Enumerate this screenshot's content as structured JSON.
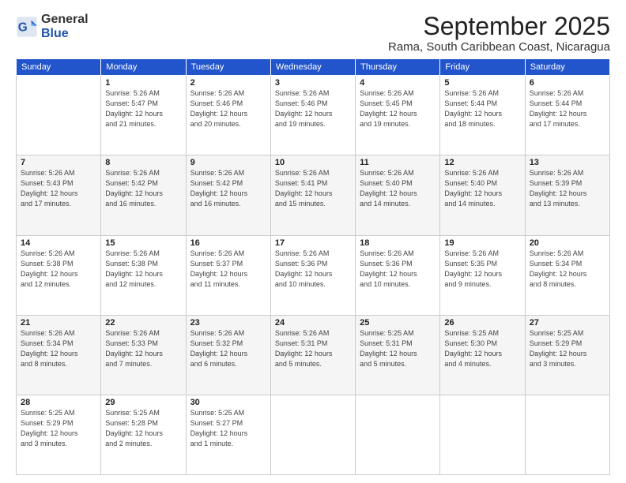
{
  "logo": {
    "text_general": "General",
    "text_blue": "Blue"
  },
  "title": "September 2025",
  "subtitle": "Rama, South Caribbean Coast, Nicaragua",
  "days_header": [
    "Sunday",
    "Monday",
    "Tuesday",
    "Wednesday",
    "Thursday",
    "Friday",
    "Saturday"
  ],
  "weeks": [
    [
      {
        "day": "",
        "info": ""
      },
      {
        "day": "1",
        "info": "Sunrise: 5:26 AM\nSunset: 5:47 PM\nDaylight: 12 hours\nand 21 minutes."
      },
      {
        "day": "2",
        "info": "Sunrise: 5:26 AM\nSunset: 5:46 PM\nDaylight: 12 hours\nand 20 minutes."
      },
      {
        "day": "3",
        "info": "Sunrise: 5:26 AM\nSunset: 5:46 PM\nDaylight: 12 hours\nand 19 minutes."
      },
      {
        "day": "4",
        "info": "Sunrise: 5:26 AM\nSunset: 5:45 PM\nDaylight: 12 hours\nand 19 minutes."
      },
      {
        "day": "5",
        "info": "Sunrise: 5:26 AM\nSunset: 5:44 PM\nDaylight: 12 hours\nand 18 minutes."
      },
      {
        "day": "6",
        "info": "Sunrise: 5:26 AM\nSunset: 5:44 PM\nDaylight: 12 hours\nand 17 minutes."
      }
    ],
    [
      {
        "day": "7",
        "info": "Sunrise: 5:26 AM\nSunset: 5:43 PM\nDaylight: 12 hours\nand 17 minutes."
      },
      {
        "day": "8",
        "info": "Sunrise: 5:26 AM\nSunset: 5:42 PM\nDaylight: 12 hours\nand 16 minutes."
      },
      {
        "day": "9",
        "info": "Sunrise: 5:26 AM\nSunset: 5:42 PM\nDaylight: 12 hours\nand 16 minutes."
      },
      {
        "day": "10",
        "info": "Sunrise: 5:26 AM\nSunset: 5:41 PM\nDaylight: 12 hours\nand 15 minutes."
      },
      {
        "day": "11",
        "info": "Sunrise: 5:26 AM\nSunset: 5:40 PM\nDaylight: 12 hours\nand 14 minutes."
      },
      {
        "day": "12",
        "info": "Sunrise: 5:26 AM\nSunset: 5:40 PM\nDaylight: 12 hours\nand 14 minutes."
      },
      {
        "day": "13",
        "info": "Sunrise: 5:26 AM\nSunset: 5:39 PM\nDaylight: 12 hours\nand 13 minutes."
      }
    ],
    [
      {
        "day": "14",
        "info": "Sunrise: 5:26 AM\nSunset: 5:38 PM\nDaylight: 12 hours\nand 12 minutes."
      },
      {
        "day": "15",
        "info": "Sunrise: 5:26 AM\nSunset: 5:38 PM\nDaylight: 12 hours\nand 12 minutes."
      },
      {
        "day": "16",
        "info": "Sunrise: 5:26 AM\nSunset: 5:37 PM\nDaylight: 12 hours\nand 11 minutes."
      },
      {
        "day": "17",
        "info": "Sunrise: 5:26 AM\nSunset: 5:36 PM\nDaylight: 12 hours\nand 10 minutes."
      },
      {
        "day": "18",
        "info": "Sunrise: 5:26 AM\nSunset: 5:36 PM\nDaylight: 12 hours\nand 10 minutes."
      },
      {
        "day": "19",
        "info": "Sunrise: 5:26 AM\nSunset: 5:35 PM\nDaylight: 12 hours\nand 9 minutes."
      },
      {
        "day": "20",
        "info": "Sunrise: 5:26 AM\nSunset: 5:34 PM\nDaylight: 12 hours\nand 8 minutes."
      }
    ],
    [
      {
        "day": "21",
        "info": "Sunrise: 5:26 AM\nSunset: 5:34 PM\nDaylight: 12 hours\nand 8 minutes."
      },
      {
        "day": "22",
        "info": "Sunrise: 5:26 AM\nSunset: 5:33 PM\nDaylight: 12 hours\nand 7 minutes."
      },
      {
        "day": "23",
        "info": "Sunrise: 5:26 AM\nSunset: 5:32 PM\nDaylight: 12 hours\nand 6 minutes."
      },
      {
        "day": "24",
        "info": "Sunrise: 5:26 AM\nSunset: 5:31 PM\nDaylight: 12 hours\nand 5 minutes."
      },
      {
        "day": "25",
        "info": "Sunrise: 5:25 AM\nSunset: 5:31 PM\nDaylight: 12 hours\nand 5 minutes."
      },
      {
        "day": "26",
        "info": "Sunrise: 5:25 AM\nSunset: 5:30 PM\nDaylight: 12 hours\nand 4 minutes."
      },
      {
        "day": "27",
        "info": "Sunrise: 5:25 AM\nSunset: 5:29 PM\nDaylight: 12 hours\nand 3 minutes."
      }
    ],
    [
      {
        "day": "28",
        "info": "Sunrise: 5:25 AM\nSunset: 5:29 PM\nDaylight: 12 hours\nand 3 minutes."
      },
      {
        "day": "29",
        "info": "Sunrise: 5:25 AM\nSunset: 5:28 PM\nDaylight: 12 hours\nand 2 minutes."
      },
      {
        "day": "30",
        "info": "Sunrise: 5:25 AM\nSunset: 5:27 PM\nDaylight: 12 hours\nand 1 minute."
      },
      {
        "day": "",
        "info": ""
      },
      {
        "day": "",
        "info": ""
      },
      {
        "day": "",
        "info": ""
      },
      {
        "day": "",
        "info": ""
      }
    ]
  ]
}
